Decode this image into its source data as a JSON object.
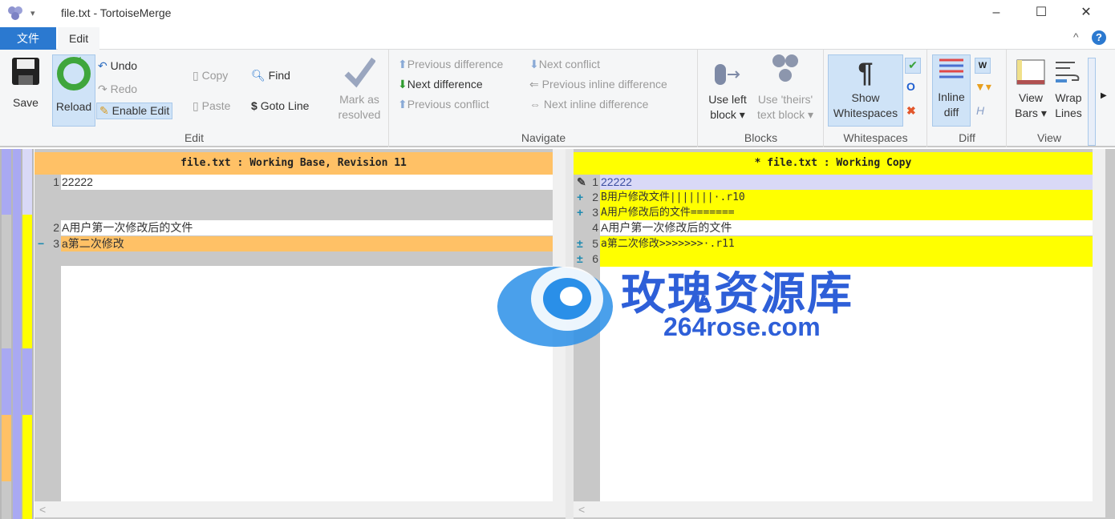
{
  "window": {
    "title": "file.txt - TortoiseMerge",
    "minimize": "–",
    "maximize": "☐",
    "close": "✕",
    "quick_access": "▾"
  },
  "tabs": [
    {
      "label": "文件",
      "active": true
    },
    {
      "label": "Edit",
      "active": false
    }
  ],
  "ribbon": {
    "collapse": "^",
    "help": "?",
    "edit_group": {
      "label": "Edit",
      "save": "Save",
      "reload": "Reload",
      "undo": "Undo",
      "redo": "Redo",
      "enable_edit": "Enable Edit",
      "copy": "Copy",
      "paste": "Paste",
      "find": "Find",
      "goto_line": "Goto Line",
      "mark_resolved": "Mark as resolved"
    },
    "navigate_group": {
      "label": "Navigate",
      "prev_diff": "Previous difference",
      "next_diff": "Next difference",
      "prev_conflict": "Previous conflict",
      "next_conflict": "Next conflict",
      "prev_inline": "Previous inline difference",
      "next_inline": "Next inline difference"
    },
    "blocks_group": {
      "label": "Blocks",
      "use_left": "Use left block ▾",
      "use_theirs": "Use 'theirs' text block ▾"
    },
    "whitespaces_group": {
      "label": "Whitespaces",
      "show": "Show Whitespaces"
    },
    "diff_group": {
      "label": "Diff",
      "inline": "Inline diff"
    },
    "view_group": {
      "label": "View",
      "view_bars": "View Bars ▾",
      "wrap_lines": "Wrap Lines"
    }
  },
  "left_pane": {
    "header": "file.txt : Working Base, Revision 11",
    "lines": [
      {
        "num": "1",
        "marker": "",
        "text": "22222",
        "state": "normal"
      },
      {
        "num": "",
        "marker": "",
        "text": "",
        "state": "empty"
      },
      {
        "num": "",
        "marker": "",
        "text": "",
        "state": "empty"
      },
      {
        "num": "2",
        "marker": "",
        "text": "A用户第一次修改后的文件",
        "state": "normal"
      },
      {
        "num": "3",
        "marker": "−",
        "text": "a第二次修改",
        "state": "removed"
      }
    ]
  },
  "right_pane": {
    "header": "* file.txt : Working Copy",
    "lines": [
      {
        "num": "1",
        "marker": "✎",
        "text": "22222",
        "state": "edited"
      },
      {
        "num": "2",
        "marker": "+",
        "text": "B用户修改文件|||||||·.r10",
        "state": "added"
      },
      {
        "num": "3",
        "marker": "+",
        "text": "A用户修改后的文件=======",
        "state": "added"
      },
      {
        "num": "4",
        "marker": "",
        "text": "A用户第一次修改后的文件",
        "state": "normal"
      },
      {
        "num": "5",
        "marker": "±",
        "text": "a第二次修改>>>>>>>·.r11",
        "state": "added"
      },
      {
        "num": "6",
        "marker": "±",
        "text": "",
        "state": "added"
      }
    ]
  },
  "scroll": {
    "left_arrow": "<",
    "right_arrow": ">",
    "up": "^",
    "down": "v"
  },
  "watermark": {
    "name": "玫瑰资源库",
    "url": "264rose.com"
  },
  "colors": {
    "accent": "#2b79d0",
    "added": "#ffff00",
    "removed": "#ffc166",
    "edited": "#d9d9f7",
    "locator_purple": "#a9a9f2",
    "empty": "#c8c8c8"
  }
}
